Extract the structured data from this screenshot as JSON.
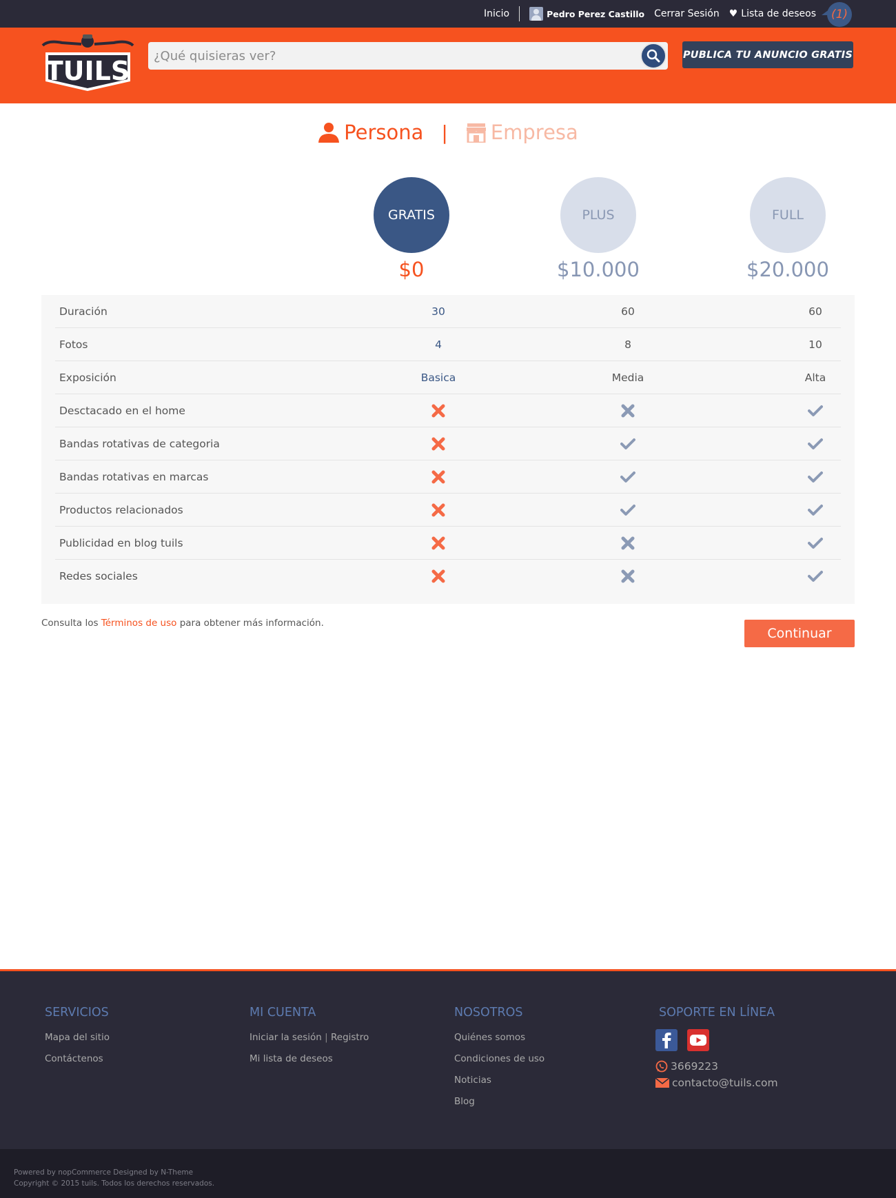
{
  "topbar": {
    "home": "Inicio",
    "user_name": "Pedro Perez Castillo",
    "logout": "Cerrar Sesión",
    "wishlist": "Lista de deseos",
    "wishlist_count": "(1)"
  },
  "header": {
    "logo_text": "TUILS",
    "search_placeholder": "¿Qué quisieras ver?",
    "publish_label": "PUBLICA TU ANUNCIO GRATIS"
  },
  "tabs": {
    "persona": "Persona",
    "separator": "|",
    "empresa": "Empresa"
  },
  "plans": [
    {
      "name": "GRATIS",
      "price": "$0"
    },
    {
      "name": "PLUS",
      "price": "$10.000"
    },
    {
      "name": "FULL",
      "price": "$20.000"
    }
  ],
  "features": [
    {
      "label": "Duración",
      "values": [
        "30",
        "60",
        "60"
      ]
    },
    {
      "label": "Fotos",
      "values": [
        "4",
        "8",
        "10"
      ]
    },
    {
      "label": "Exposición",
      "values": [
        "Basica",
        "Media",
        "Alta"
      ]
    },
    {
      "label": "Desctacado en el home",
      "values": [
        "no",
        "no",
        "yes"
      ]
    },
    {
      "label": "Bandas rotativas de categoria",
      "values": [
        "no",
        "yes",
        "yes"
      ]
    },
    {
      "label": "Bandas rotativas en marcas",
      "values": [
        "no",
        "yes",
        "yes"
      ]
    },
    {
      "label": "Productos relacionados",
      "values": [
        "no",
        "yes",
        "yes"
      ]
    },
    {
      "label": "Publicidad en blog tuils",
      "values": [
        "no",
        "no",
        "yes"
      ]
    },
    {
      "label": "Redes sociales",
      "values": [
        "no",
        "no",
        "yes"
      ]
    }
  ],
  "terms": {
    "prefix": "Consulta los ",
    "link": "Términos de uso",
    "suffix": " para obtener más información."
  },
  "continue_label": "Continuar",
  "footer": {
    "servicios": {
      "title": "SERVICIOS",
      "links": [
        "Mapa del sitio",
        "Contáctenos"
      ]
    },
    "cuenta": {
      "title": "MI CUENTA",
      "login": "Iniciar la sesión",
      "pipe": "|",
      "register": "Registro",
      "wishlist": "Mi lista de deseos"
    },
    "nosotros": {
      "title": "NOSOTROS",
      "links": [
        "Quiénes somos",
        "Condiciones de uso",
        "Noticias",
        "Blog"
      ]
    },
    "soporte": {
      "title": "SOPORTE EN LÍNEA",
      "phone": "3669223",
      "email": "contacto@tuils.com"
    }
  },
  "bottom": {
    "powered": "Powered by nopCommerce Designed by N-Theme",
    "copyright": "Copyright © 2015 tuils. Todos los derechos reservados."
  },
  "colors": {
    "brand_orange": "#f6521f",
    "navy": "#3a5785",
    "dark": "#2b2a38",
    "cross": "#f56a46",
    "muted": "#8b9ab5"
  },
  "icons": {
    "yes": "check-icon",
    "no": "cross-icon"
  }
}
